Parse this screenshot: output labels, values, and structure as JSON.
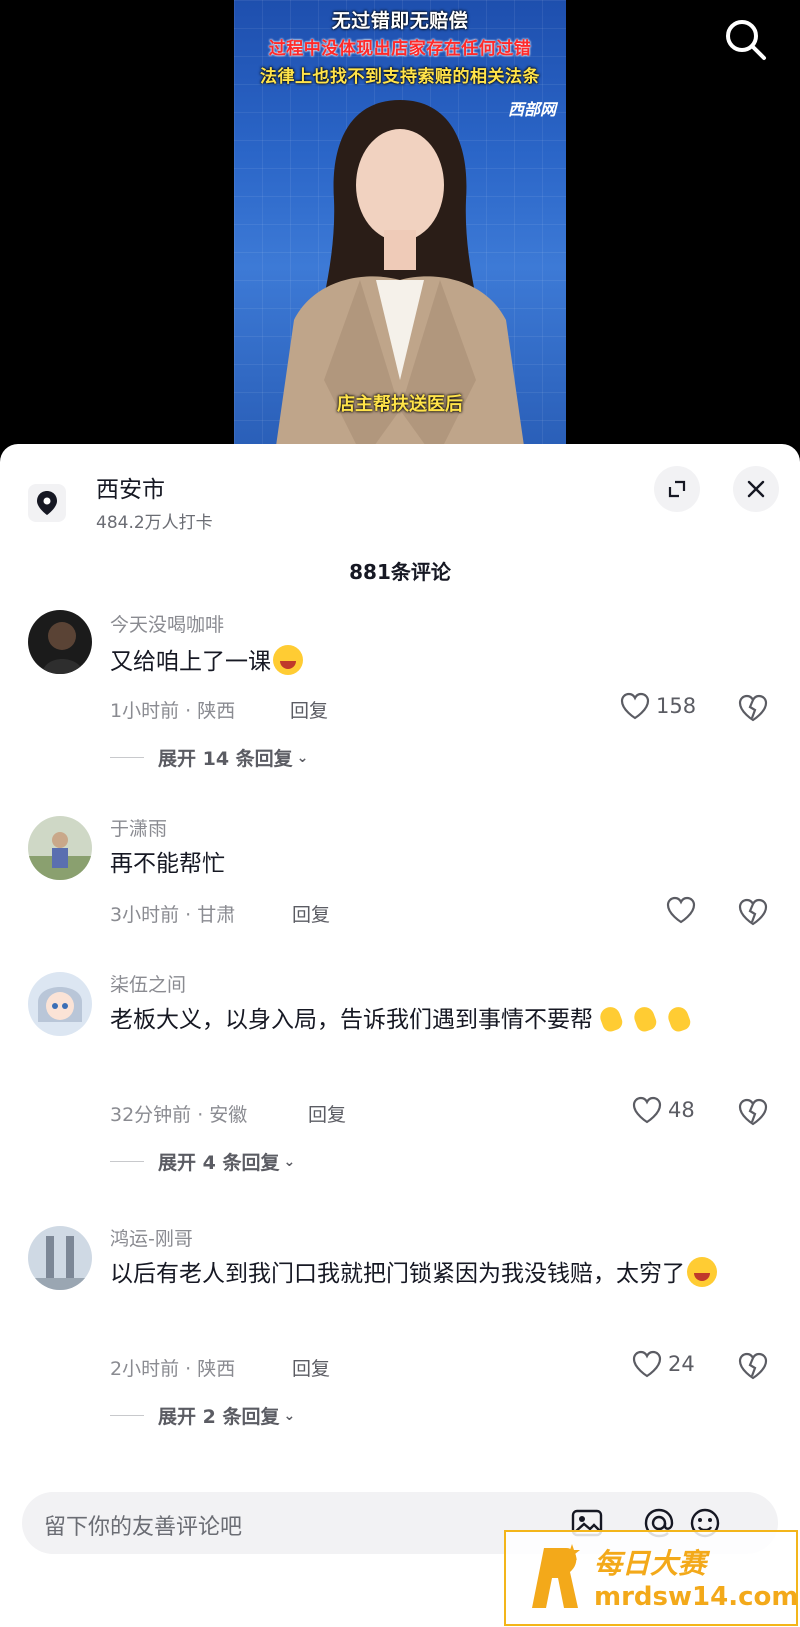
{
  "video": {
    "caption_line1": "无过错即无赔偿",
    "caption_line2": "过程中没体现出店家存在任何过错",
    "caption_line3": "法律上也找不到支持索赔的相关法条",
    "brand": "西部网",
    "subtitle": "店主帮扶送医后"
  },
  "location": {
    "name": "西安市",
    "checkins": "484.2万人打卡"
  },
  "comments_header": {
    "count_label": "881条评论"
  },
  "comments": [
    {
      "username": "今天没喝咖啡",
      "text": "又给咱上了一课",
      "emoji": "crying-face",
      "time_location": "1小时前 · 陕西",
      "reply_label": "回复",
      "likes": "158",
      "expand_label": "展开 14 条回复"
    },
    {
      "username": "于潇雨",
      "text": "再不能帮忙",
      "time_location": "3小时前 · 甘肃",
      "reply_label": "回复",
      "likes": ""
    },
    {
      "username": "柒伍之间",
      "text": "老板大义，以身入局，告诉我们遇到事情不要帮",
      "emoji": "clapping-hands",
      "time_location": "32分钟前 · 安徽",
      "reply_label": "回复",
      "likes": "48",
      "expand_label": "展开 4 条回复"
    },
    {
      "username": "鸿运-刚哥",
      "text": "以后有老人到我门口我就把门锁紧因为我没钱赔，太穷了",
      "emoji": "laughing-crying-face",
      "time_location": "2小时前 · 陕西",
      "reply_label": "回复",
      "likes": "24",
      "expand_label": "展开 2 条回复"
    }
  ],
  "input": {
    "placeholder": "留下你的友善评论吧"
  },
  "watermark": {
    "title": "每日大赛",
    "url": "mrdsw14.com"
  },
  "colors": {
    "accent": "#f3a91a",
    "text": "#161823",
    "muted": "#8a8b91",
    "sheet_bg": "#ffffff"
  }
}
